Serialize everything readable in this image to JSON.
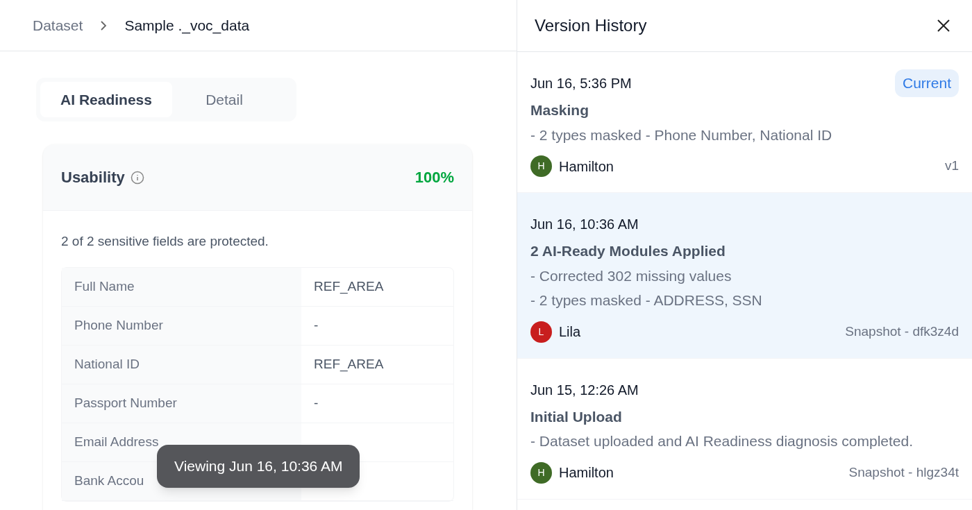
{
  "breadcrumb": [
    "Dataset",
    "Sample ._voc_data"
  ],
  "tabs": [
    {
      "label": "AI Readiness",
      "selected": true
    },
    {
      "label": "Detail",
      "selected": false
    }
  ],
  "usability": {
    "title": "Usability",
    "score": "100%",
    "summary": "2 of 2 sensitive fields are protected.",
    "rows": [
      {
        "field": "Full Name",
        "value": "REF_AREA"
      },
      {
        "field": "Phone Number",
        "value": "-"
      },
      {
        "field": "National ID",
        "value": "REF_AREA"
      },
      {
        "field": "Passport Number",
        "value": "-"
      },
      {
        "field": "Email Address"
      },
      {
        "field": "Bank Accou"
      }
    ]
  },
  "toast": "Viewing Jun 16, 10:36 AM",
  "panel": {
    "title": "Version History",
    "versions": [
      {
        "time": "Jun 16, 5:36 PM",
        "badge": "Current",
        "title": "Masking",
        "details": [
          "- 2 types masked - Phone Number, National ID"
        ],
        "user": "Hamilton",
        "initial": "H",
        "color": "#3f6b26",
        "tag": "v1",
        "selected": false
      },
      {
        "time": "Jun 16, 10:36 AM",
        "title": "2 AI-Ready Modules Applied",
        "details": [
          "- Corrected 302 missing values",
          "- 2 types masked - ADDRESS, SSN"
        ],
        "user": "Lila",
        "initial": "L",
        "color": "#c81e1e",
        "tag": "Snapshot - dfk3z4d",
        "selected": true
      },
      {
        "time": "Jun 15, 12:26 AM",
        "title": "Initial Upload",
        "details": [
          "- Dataset uploaded and AI Readiness diagnosis completed."
        ],
        "user": "Hamilton",
        "initial": "H",
        "color": "#3f6b26",
        "tag": "Snapshot - hlgz34t",
        "selected": false
      }
    ]
  }
}
